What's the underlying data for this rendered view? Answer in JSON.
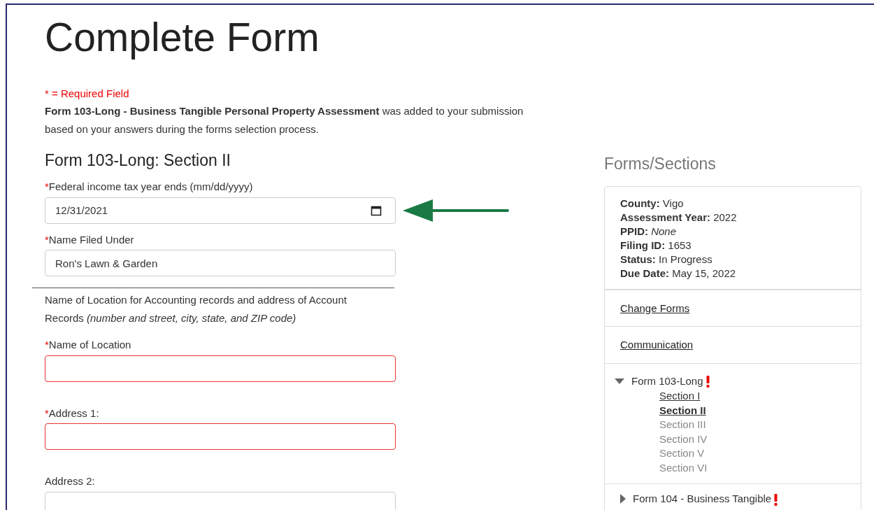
{
  "page_title": "Complete Form",
  "required_note": "* = Required Field",
  "intro": "**Form 103-Long - Business Tangible Personal Property Assessment** was added to your submission based on your answers during the forms selection process.",
  "section_heading": "Form 103-Long: Section II",
  "fields_top": [
    {
      "kind": "date",
      "required_mark": "*",
      "label": "Federal income tax year ends (mm/dd/yyyy)",
      "value": "12/31/2021",
      "invalid": false
    },
    {
      "kind": "text",
      "required_mark": "*",
      "label": "Name Filed Under",
      "value": "Ron's Lawn & Garden",
      "invalid": false
    }
  ],
  "location_note": "Name of Location for Accounting records and address of Account Records *(number and street, city, state, and ZIP code)*",
  "fields_location": [
    {
      "required_mark": "*",
      "label": "Name of Location",
      "invalid": true
    },
    {
      "required_mark": "*",
      "label": "Address 1:",
      "invalid": true
    },
    {
      "label": "Address 2:",
      "invalid": false
    }
  ],
  "sidebar": {
    "heading": "Forms/Sections",
    "info": [
      "**County:** Vigo",
      "**Assessment Year:** 2022",
      "**PPID:** *None*",
      "**Filing ID:** 1653",
      "**Status:** In Progress",
      "**Due Date:** May 15, 2022"
    ],
    "links": [
      "Change Forms",
      "Communication"
    ],
    "forms": [
      {
        "label": "Form 103-Long",
        "expanded": true,
        "warning": true,
        "sections": [
          {
            "label": "Section I",
            "selected": false,
            "disabled": false
          },
          {
            "label": "Section II",
            "selected": true,
            "disabled": false
          },
          {
            "label": "Section III",
            "selected": false,
            "disabled": true
          },
          {
            "label": "Section IV",
            "selected": false,
            "disabled": true
          },
          {
            "label": "Section V",
            "selected": false,
            "disabled": true
          },
          {
            "label": "Section VI",
            "selected": false,
            "disabled": true
          }
        ]
      },
      {
        "label": "Form 104 - Business Tangible",
        "expanded": false,
        "warning": true
      }
    ]
  }
}
